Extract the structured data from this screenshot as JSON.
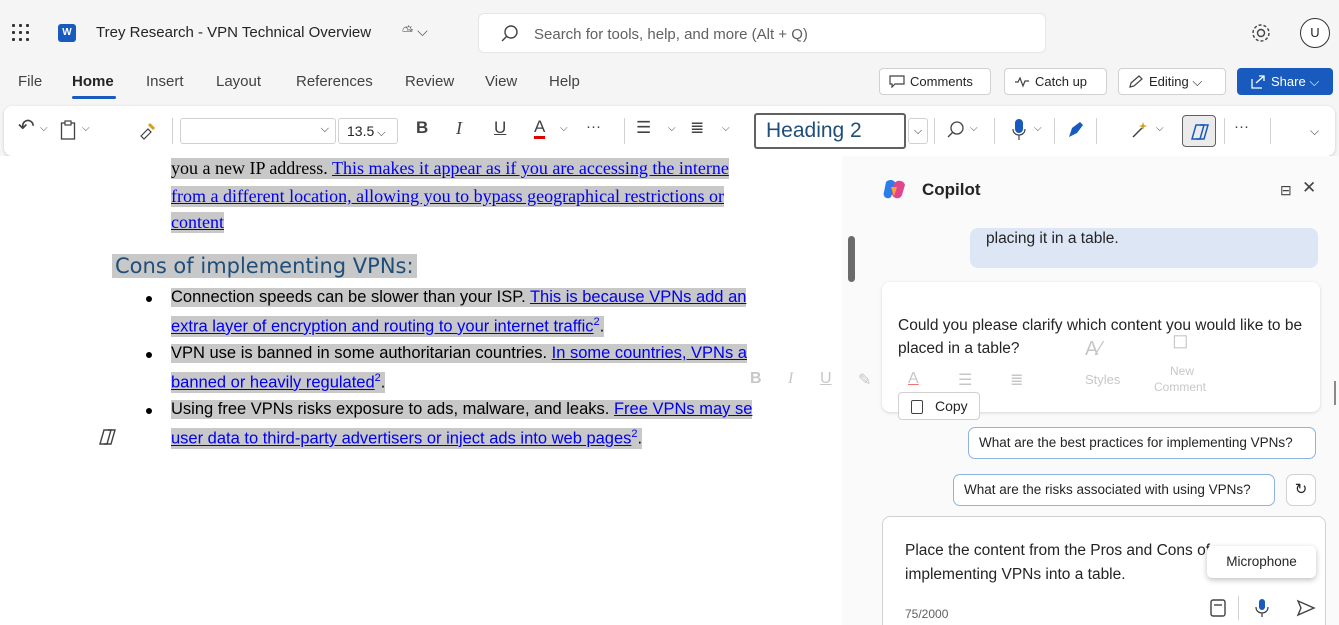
{
  "app": {
    "document_title": "Trey Research - VPN Technical Overview"
  },
  "search": {
    "placeholder": "Search for tools, help, and more (Alt + Q)"
  },
  "user": {
    "avatar_initial": "U"
  },
  "ribbon": {
    "tabs": [
      "File",
      "Home",
      "Insert",
      "Layout",
      "References",
      "Review",
      "View",
      "Help"
    ],
    "active_tab": "Home",
    "comments_label": "Comments",
    "catchup_label": "Catch up",
    "editing_label": "Editing",
    "share_label": "Share"
  },
  "toolbar": {
    "font_size": "13.5",
    "bold": "B",
    "italic": "I",
    "underline": "U",
    "font_color": "A",
    "more": "···",
    "style": "Heading 2"
  },
  "document": {
    "intro_line1_plain": "you a new IP address. ",
    "intro_line1_link": "This makes it appear as if you are accessing the interne",
    "intro_line2_link": "from a different location, allowing you to bypass geographical restrictions or",
    "intro_line3_link": "content",
    "cons_heading": "Cons of implementing VPNs:",
    "cons": [
      {
        "plain": "Connection speeds can be slower than your ISP. ",
        "link1": "This is because VPNs add an",
        "link2": "extra layer of encryption and routing to your internet traffic",
        "ref": "2"
      },
      {
        "plain": "VPN use is banned in some authoritarian countries. ",
        "link1": "In some countries, VPNs a",
        "link2": "banned or heavily regulated",
        "ref": "2"
      },
      {
        "plain": "Using free VPNs risks exposure to ads, malware, and leaks. ",
        "link1": "Free VPNs may se",
        "link2": "user data to third-party advertisers or inject ads into web pages",
        "ref": "2"
      }
    ]
  },
  "mini_toolbar": {
    "styles": "Styles",
    "new_comment_line1": "New",
    "new_comment_line2": "Comment"
  },
  "copilot": {
    "title": "Copilot",
    "user_message_tail": "placing it in a table.",
    "ai_response": "Could you please clarify which content you would like to be placed in a table?",
    "copy_label": "Copy",
    "suggestions": [
      "What are the best practices for implementing VPNs?",
      "What are the risks associated with using VPNs?"
    ],
    "composer_text": "Place the content from the Pros and Cons of implementing VPNs into a table.",
    "char_count": "75/2000",
    "tooltip": "Microphone"
  },
  "colors": {
    "accent": "#185abd",
    "heading": "#1f4e79",
    "link": "#0000ee",
    "highlight": "#c8c8c8"
  }
}
